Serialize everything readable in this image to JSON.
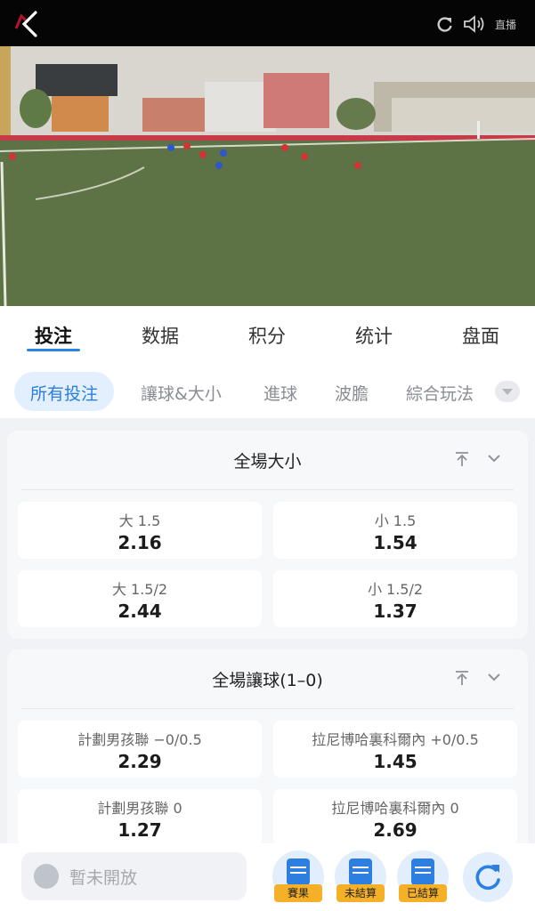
{
  "player": {
    "live_label": "直播",
    "icons": {
      "back": "back-arrow-icon",
      "refresh": "refresh-icon",
      "sound": "speaker-icon"
    }
  },
  "main_tabs": [
    {
      "label": "投注",
      "active": true
    },
    {
      "label": "数据"
    },
    {
      "label": "积分"
    },
    {
      "label": "统计"
    },
    {
      "label": "盘面"
    }
  ],
  "sub_tabs": [
    {
      "label": "所有投注",
      "active": true
    },
    {
      "label": "讓球&大小"
    },
    {
      "label": "進球"
    },
    {
      "label": "波膽"
    },
    {
      "label": "綜合玩法"
    }
  ],
  "markets": [
    {
      "title": "全場大小",
      "options": [
        {
          "name": "大 1.5",
          "odds": "2.16"
        },
        {
          "name": "小 1.5",
          "odds": "1.54"
        },
        {
          "name": "大 1.5/2",
          "odds": "2.44"
        },
        {
          "name": "小 1.5/2",
          "odds": "1.37"
        }
      ]
    },
    {
      "title": "全場讓球(1–0)",
      "options": [
        {
          "name": "計劃男孩聯 −0/0.5",
          "odds": "2.29"
        },
        {
          "name": "拉尼博哈裏科爾內 +0/0.5",
          "odds": "1.45"
        },
        {
          "name": "計劃男孩聯 0",
          "odds": "1.27"
        },
        {
          "name": "拉尼博哈裏科爾內 0",
          "odds": "2.69"
        }
      ]
    }
  ],
  "bottom_bar": {
    "chat_placeholder": "暫未開放",
    "actions": [
      "賽果",
      "未結算",
      "已結算"
    ]
  },
  "colors": {
    "accent": "#2a84e8",
    "badge": "#f5b027"
  }
}
